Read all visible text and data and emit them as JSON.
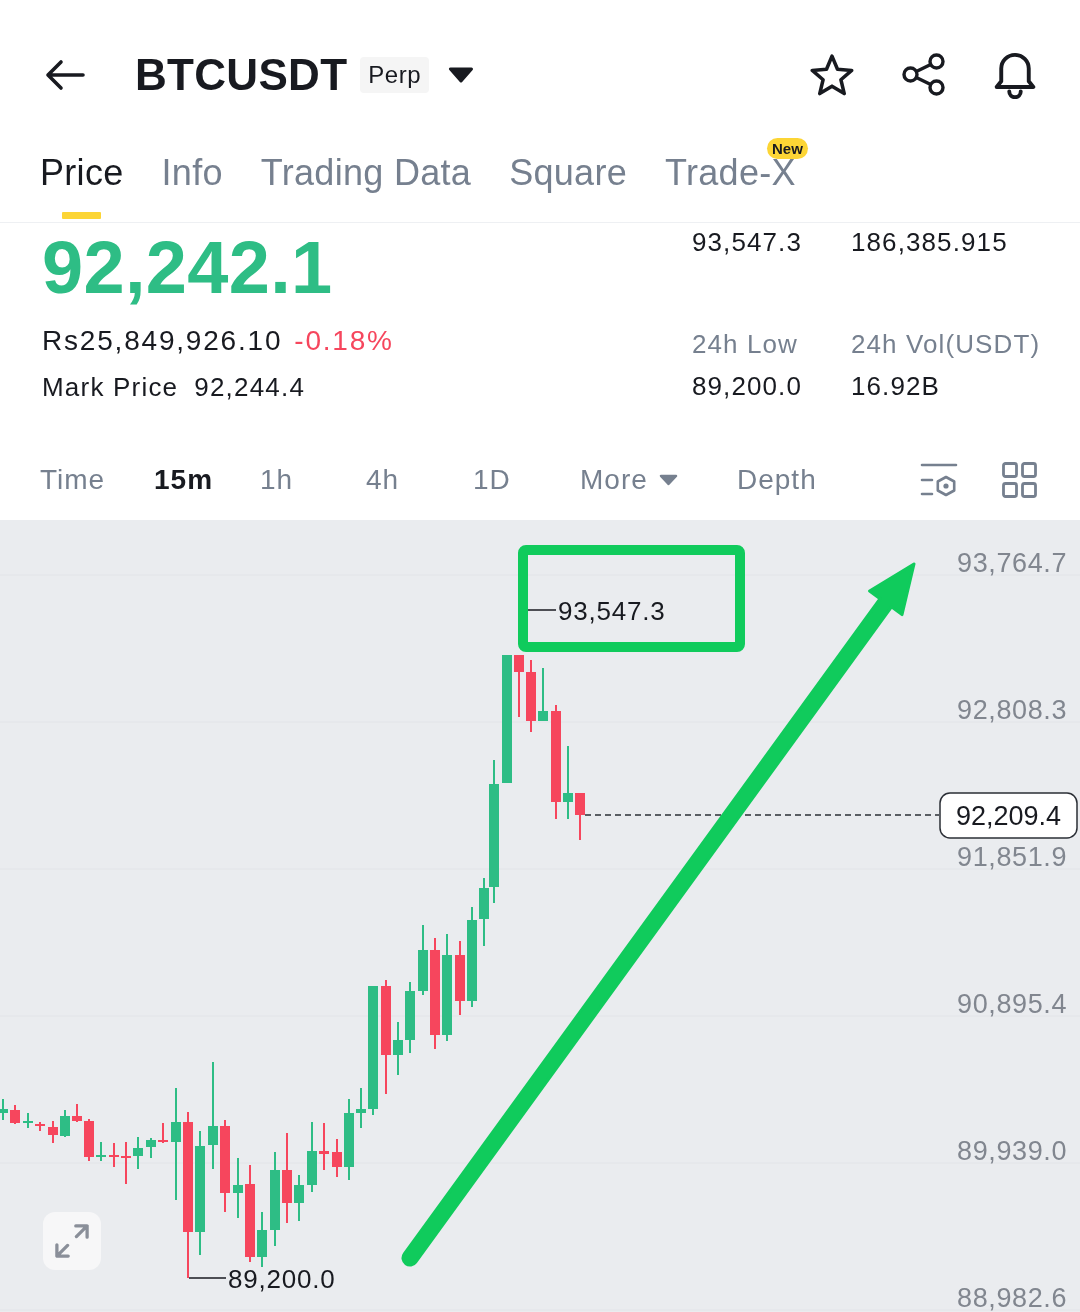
{
  "header": {
    "symbol": "BTCUSDT",
    "contract": "Perp"
  },
  "tabs": [
    {
      "label": "Price",
      "selected": true
    },
    {
      "label": "Info",
      "selected": false
    },
    {
      "label": "Trading Data",
      "selected": false
    },
    {
      "label": "Square",
      "selected": false
    },
    {
      "label": "Trade-X",
      "selected": false,
      "badge": "New"
    }
  ],
  "ticker": {
    "last_price": "92,242.1",
    "local_price": "Rs25,849,926.10",
    "change": "-0.18%",
    "mark_price_label": "Mark Price",
    "mark_price": "92,244.4"
  },
  "stats": [
    {
      "value": "93,547.3"
    },
    {
      "value": "186,385.915"
    },
    {
      "label": "24h Low",
      "value": "89,200.0"
    },
    {
      "label": "24h Vol(USDT)",
      "value": "16.92B"
    }
  ],
  "intervals": [
    {
      "label": "Time",
      "kind": "option",
      "selected": false
    },
    {
      "label": "15m",
      "kind": "option",
      "selected": true
    },
    {
      "label": "1h",
      "kind": "option",
      "selected": false
    },
    {
      "label": "4h",
      "kind": "option",
      "selected": false
    },
    {
      "label": "1D",
      "kind": "option",
      "selected": false
    },
    {
      "label": "More",
      "kind": "dropdown",
      "selected": false
    },
    {
      "label": "Depth",
      "kind": "option",
      "selected": false
    }
  ],
  "chart": {
    "price_scale": [
      "93,764.7",
      "92,808.3",
      "91,851.9",
      "90,895.4",
      "89,939.0",
      "88,982.6"
    ],
    "high_label": "93,547.3",
    "low_label": "89,200.0",
    "last_price": "92,209.4"
  }
}
